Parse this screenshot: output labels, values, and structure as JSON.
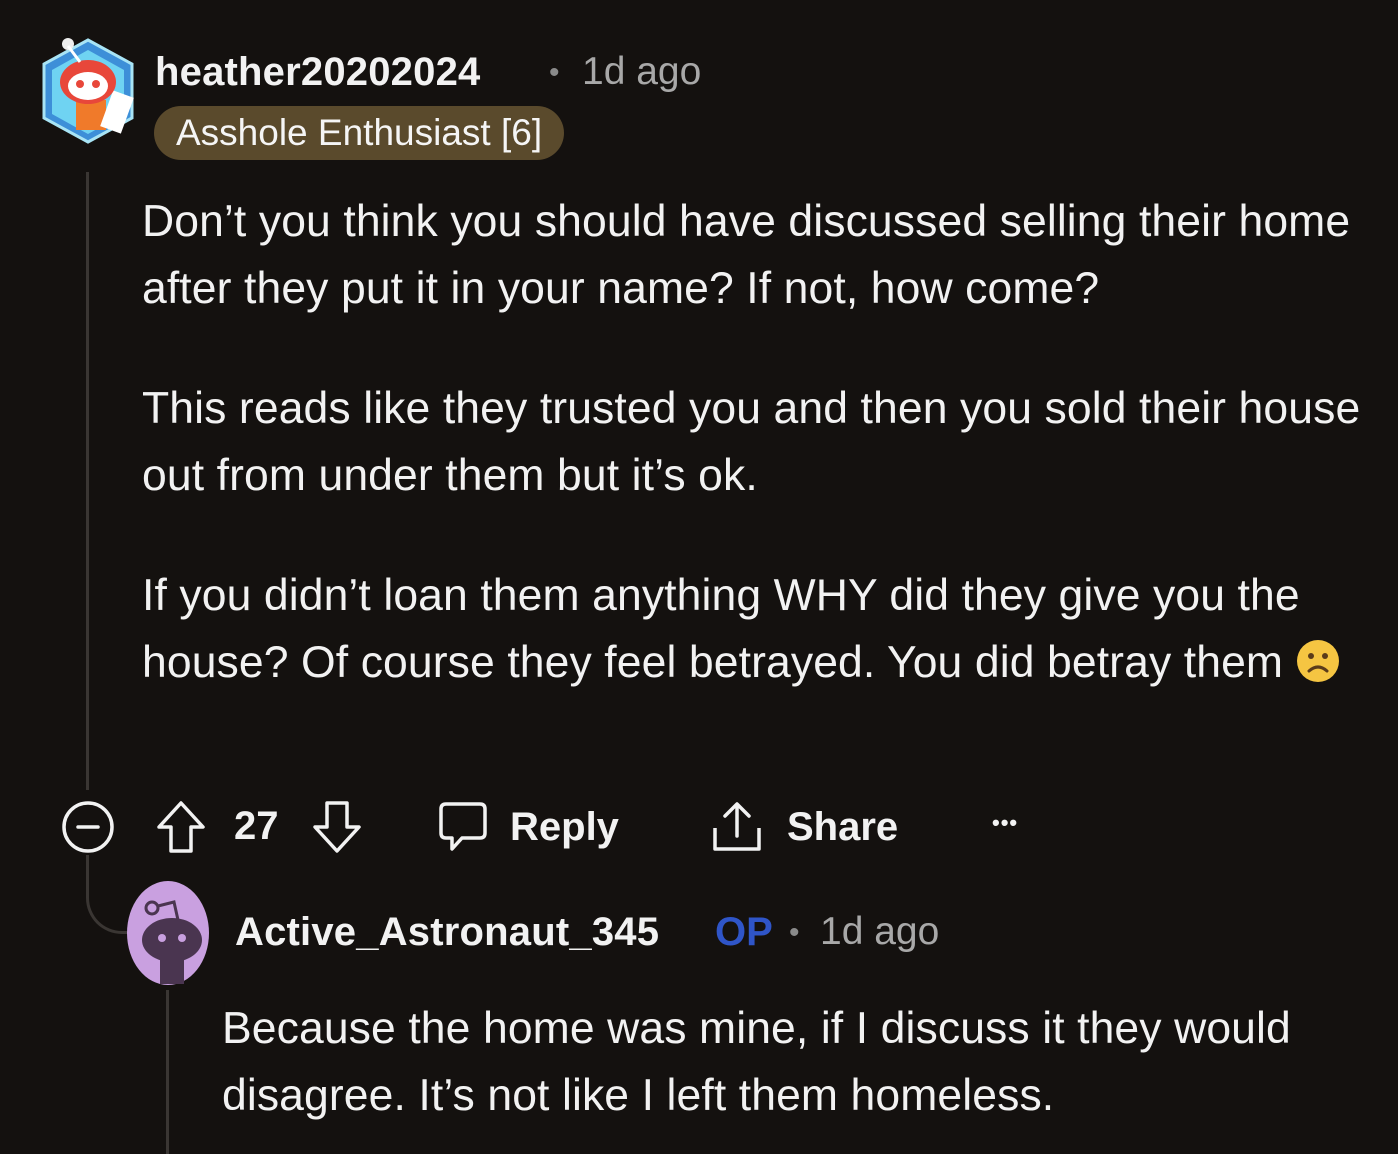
{
  "parent_comment": {
    "username": "heather20202024",
    "separator": "•",
    "time": "1d ago",
    "flair": "Asshole Enthusiast [6]",
    "paragraphs": [
      "Don’t you think you should have discussed selling their home after they put it in your name? If not, how come?",
      "This reads like they trusted you and then you sold their house out from under them but it’s ok.",
      "If you didn’t loan them anything WHY did they give you the house? Of course they feel betrayed. You did betray them"
    ],
    "emoji": "☹",
    "actions": {
      "collapse_icon": "collapse-minus-icon",
      "upvote_icon": "arrow-up-icon",
      "vote_count": "27",
      "downvote_icon": "arrow-down-icon",
      "reply_label": "Reply",
      "reply_icon": "speech-bubble-icon",
      "share_label": "Share",
      "share_icon": "share-upload-icon",
      "more_label": "•••"
    }
  },
  "reply_comment": {
    "username": "Active_Astronaut_345",
    "op_badge": "OP",
    "separator": "•",
    "time": "1d ago",
    "paragraphs": [
      "Because the home was mine, if I discuss it they would disagree. It’s not like I left them homeless."
    ]
  },
  "colors": {
    "background": "#14110f",
    "flair_bg": "#5a4a2c",
    "op_blue": "#2f55c8",
    "thread_line": "#3a3633",
    "reply_avatar": "#c9a0e0"
  }
}
